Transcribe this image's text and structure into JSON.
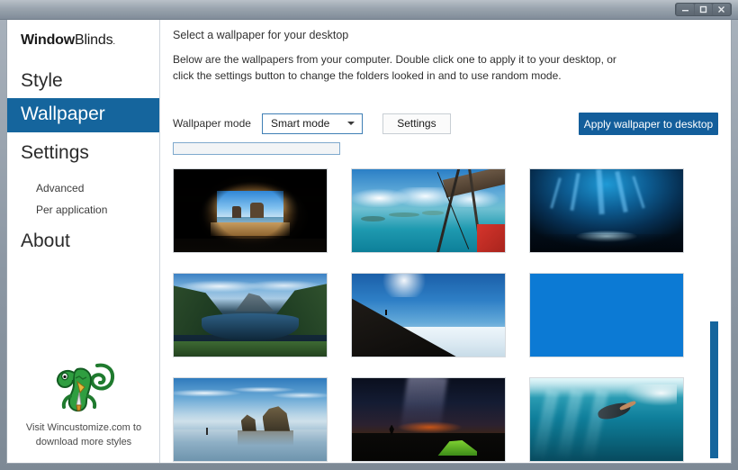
{
  "window": {
    "controls": [
      {
        "name": "minimize",
        "glyph": "minimize-icon"
      },
      {
        "name": "maximize",
        "glyph": "maximize-icon"
      },
      {
        "name": "close",
        "glyph": "close-icon"
      }
    ]
  },
  "brand": {
    "bold": "Window",
    "light": "Blinds",
    "mark": "."
  },
  "sidebar": {
    "items": [
      {
        "label": "Style",
        "level": "main",
        "active": false
      },
      {
        "label": "Wallpaper",
        "level": "main",
        "active": true
      },
      {
        "label": "Settings",
        "level": "main",
        "active": false
      },
      {
        "label": "Advanced",
        "level": "sub",
        "active": false
      },
      {
        "label": "Per application",
        "level": "sub",
        "active": false
      },
      {
        "label": "About",
        "level": "main",
        "active": false
      }
    ],
    "promo": {
      "line1": "Visit Wincustomize.com to",
      "line2": "download more styles",
      "icon": "lizard-mascot-icon"
    }
  },
  "main": {
    "title": "Select a wallpaper for your desktop",
    "description": "Below are the wallpapers from your computer.  Double click one to apply it to your desktop, or click the settings button to change the folders looked in and to use random mode."
  },
  "toolbar": {
    "mode_label": "Wallpaper mode",
    "mode_value": "Smart mode",
    "mode_options": [
      "Smart mode"
    ],
    "settings_label": "Settings",
    "apply_label": "Apply wallpaper to desktop"
  },
  "gallery": {
    "thumbnails": [
      {
        "name": "wallpaper-cave-beach-arch",
        "art": "w-cave"
      },
      {
        "name": "wallpaper-biplane-tropical-islands",
        "art": "w-plane"
      },
      {
        "name": "wallpaper-blue-ice-cave",
        "art": "w-ice"
      },
      {
        "name": "wallpaper-fjord-lake-reflection",
        "art": "w-fjord"
      },
      {
        "name": "wallpaper-ridge-above-clouds",
        "art": "w-ridge"
      },
      {
        "name": "wallpaper-solid-blue",
        "art": "w-blue"
      },
      {
        "name": "wallpaper-wharariki-beach-stacks",
        "art": "w-beach"
      },
      {
        "name": "wallpaper-milky-way-green-tent",
        "art": "w-night"
      },
      {
        "name": "wallpaper-underwater-swimmer",
        "art": "w-water"
      }
    ]
  },
  "colors": {
    "accent": "#15659d",
    "apply_button": "#135e9b",
    "select_border": "#3f7fb5",
    "titlebar": "#9aa4ae"
  }
}
